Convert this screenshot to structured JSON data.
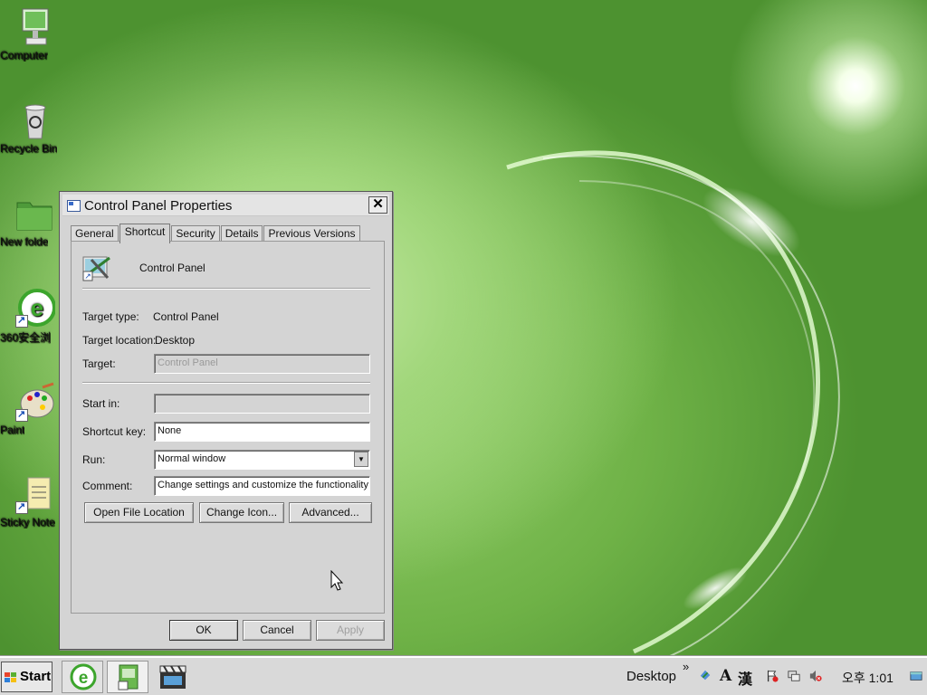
{
  "desktop": {
    "icons": [
      {
        "label": "Computer"
      },
      {
        "label": "Recycle Bin"
      },
      {
        "label": "New folde"
      },
      {
        "label": "360安全浏"
      },
      {
        "label": "Paint"
      },
      {
        "label": "Sticky Note"
      }
    ]
  },
  "dialog": {
    "title": "Control Panel Properties",
    "close": "✕",
    "tabs": [
      "General",
      "Shortcut",
      "Security",
      "Details",
      "Previous Versions"
    ],
    "active_tab": "Shortcut",
    "name": "Control Panel",
    "target_type_label": "Target type:",
    "target_type_value": "Control Panel",
    "target_location_label": "Target location:",
    "target_location_value": "Desktop",
    "target_label": "Target:",
    "target_value": "Control Panel",
    "start_in_label": "Start in:",
    "start_in_value": "",
    "shortcut_key_label": "Shortcut key:",
    "shortcut_key_value": "None",
    "run_label": "Run:",
    "run_value": "Normal window",
    "comment_label": "Comment:",
    "comment_value": "Change settings and customize the functionality o",
    "open_file_location": "Open File Location",
    "change_icon": "Change Icon...",
    "advanced": "Advanced...",
    "ok": "OK",
    "cancel": "Cancel",
    "apply": "Apply"
  },
  "taskbar": {
    "start": "Start",
    "desktop_toolbar": "Desktop",
    "chevron": "»",
    "ime_lang": "A",
    "ime_hanja": "漢",
    "clock": "오후 1:01"
  }
}
